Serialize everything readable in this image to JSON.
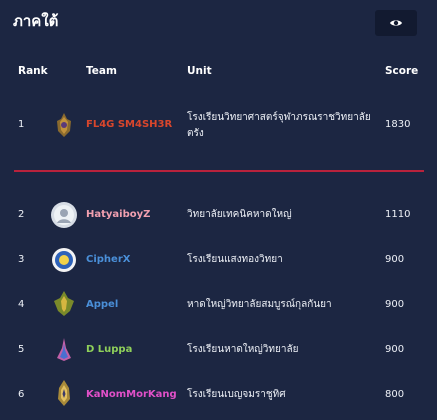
{
  "panel": {
    "title": "ภาคใต้"
  },
  "headers": {
    "rank": "Rank",
    "team": "Team",
    "unit": "Unit",
    "score": "Score"
  },
  "colors": {
    "background": "#1c2642",
    "divider": "#b8223c"
  },
  "rows": [
    {
      "rank": "1",
      "team": "FL4G SM4SH3R",
      "team_color": "#d9462c",
      "unit": "โรงเรียนวิทยาศาสตร์จุฬาภรณราชวิทยาลัย ตรัง",
      "score": "1830",
      "icon": "school-emblem-icon"
    },
    {
      "rank": "2",
      "team": "HatyaiboyZ",
      "team_color": "#f2a0b0",
      "unit": "วิทยาลัยเทคนิคหาดใหญ่",
      "score": "1110",
      "icon": "team-avatar-icon"
    },
    {
      "rank": "3",
      "team": "CipherX",
      "team_color": "#4a8fd8",
      "unit": "โรงเรียนแสงทองวิทยา",
      "score": "900",
      "icon": "school-emblem-icon"
    },
    {
      "rank": "4",
      "team": "Appel",
      "team_color": "#4a8fd8",
      "unit": "หาดใหญ่วิทยาลัยสมบูรณ์กุลกันยา",
      "score": "900",
      "icon": "school-emblem-icon"
    },
    {
      "rank": "5",
      "team": "D Luppa",
      "team_color": "#8fd05a",
      "unit": "โรงเรียนหาดใหญ่วิทยาลัย",
      "score": "900",
      "icon": "school-emblem-icon"
    },
    {
      "rank": "6",
      "team": "KaNomMorKang",
      "team_color": "#e050c8",
      "unit": "โรงเรียนเบญจมราชูทิศ",
      "score": "800",
      "icon": "school-emblem-icon"
    }
  ]
}
